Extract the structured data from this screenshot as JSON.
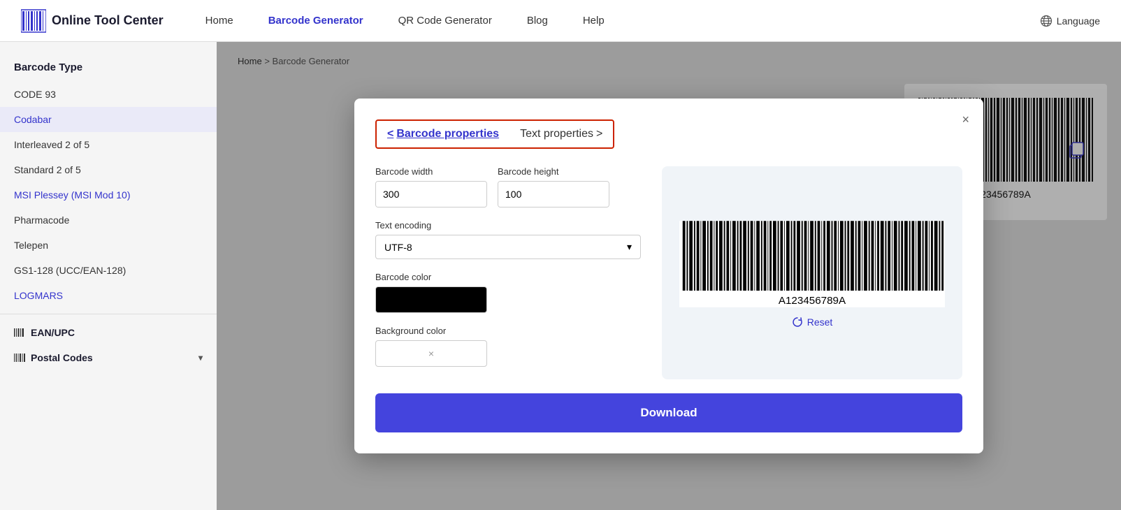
{
  "header": {
    "logo_text": "Online Tool Center",
    "nav": [
      {
        "label": "Home",
        "active": false
      },
      {
        "label": "Barcode Generator",
        "active": true
      },
      {
        "label": "QR Code Generator",
        "active": false
      },
      {
        "label": "Blog",
        "active": false
      },
      {
        "label": "Help",
        "active": false
      }
    ],
    "language_label": "Language"
  },
  "sidebar": {
    "section_title": "Barcode Type",
    "items": [
      {
        "label": "CODE 93",
        "active": false,
        "blue": false
      },
      {
        "label": "Codabar",
        "active": true,
        "blue": true
      },
      {
        "label": "Interleaved 2 of 5",
        "active": false,
        "blue": false
      },
      {
        "label": "Standard 2 of 5",
        "active": false,
        "blue": false
      },
      {
        "label": "MSI Plessey (MSI Mod 10)",
        "active": false,
        "blue": true
      },
      {
        "label": "Pharmacode",
        "active": false,
        "blue": false
      },
      {
        "label": "Telepen",
        "active": false,
        "blue": false
      },
      {
        "label": "GS1-128 (UCC/EAN-128)",
        "active": false,
        "blue": false
      },
      {
        "label": "LOGMARS",
        "active": false,
        "blue": true
      }
    ],
    "groups": [
      {
        "label": "EAN/UPC"
      },
      {
        "label": "Postal Codes"
      }
    ]
  },
  "breadcrumb": {
    "home": "Home",
    "separator": ">",
    "current": "Barcode Generator"
  },
  "modal": {
    "tab_barcode_label": "Barcode properties",
    "tab_text_label": "Text properties",
    "tab_barcode_arrow_left": "<",
    "tab_text_arrow_right": ">",
    "close_symbol": "×",
    "barcode_width_label": "Barcode width",
    "barcode_width_value": "300",
    "barcode_height_label": "Barcode height",
    "barcode_height_value": "100",
    "text_encoding_label": "Text encoding",
    "text_encoding_value": "UTF-8",
    "barcode_color_label": "Barcode color",
    "background_color_label": "Background color",
    "background_color_x": "×",
    "barcode_value": "A123456789A",
    "reset_label": "Reset",
    "download_label": "Download"
  }
}
